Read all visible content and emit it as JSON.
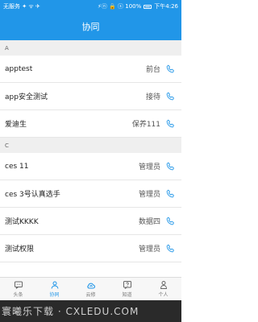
{
  "status_bar": {
    "left_text": "无服务 ✦ ᯤ ✈",
    "right_text": "⚡ⓝ 🔒 ⓢ 100%",
    "time": "下午4:26"
  },
  "header": {
    "title": "协同"
  },
  "sections": [
    {
      "letter": "A",
      "contacts": [
        {
          "name": "apptest",
          "role": "前台"
        },
        {
          "name": "app安全测试",
          "role": "接待"
        },
        {
          "name": "爱迪生",
          "role": "保养111"
        }
      ]
    },
    {
      "letter": "C",
      "contacts": [
        {
          "name": "ces 11",
          "role": "管理员"
        },
        {
          "name": "ces 3号认真选手",
          "role": "管理员"
        },
        {
          "name": "测试KKKK",
          "role": "数据四"
        },
        {
          "name": "测试权限",
          "role": "管理员"
        }
      ]
    }
  ],
  "tab_bar": {
    "active_index": 1,
    "tabs": [
      {
        "label": "头条",
        "icon": "chat-icon"
      },
      {
        "label": "协同",
        "icon": "user-icon"
      },
      {
        "label": "云修",
        "icon": "cloud-icon"
      },
      {
        "label": "知道",
        "icon": "question-icon"
      },
      {
        "label": "个人",
        "icon": "person-icon"
      }
    ]
  },
  "watermark": {
    "text": "寰曦乐下载 · CXLEDU.COM"
  },
  "colors": {
    "accent": "#2196e8",
    "section_bg": "#efefef"
  }
}
